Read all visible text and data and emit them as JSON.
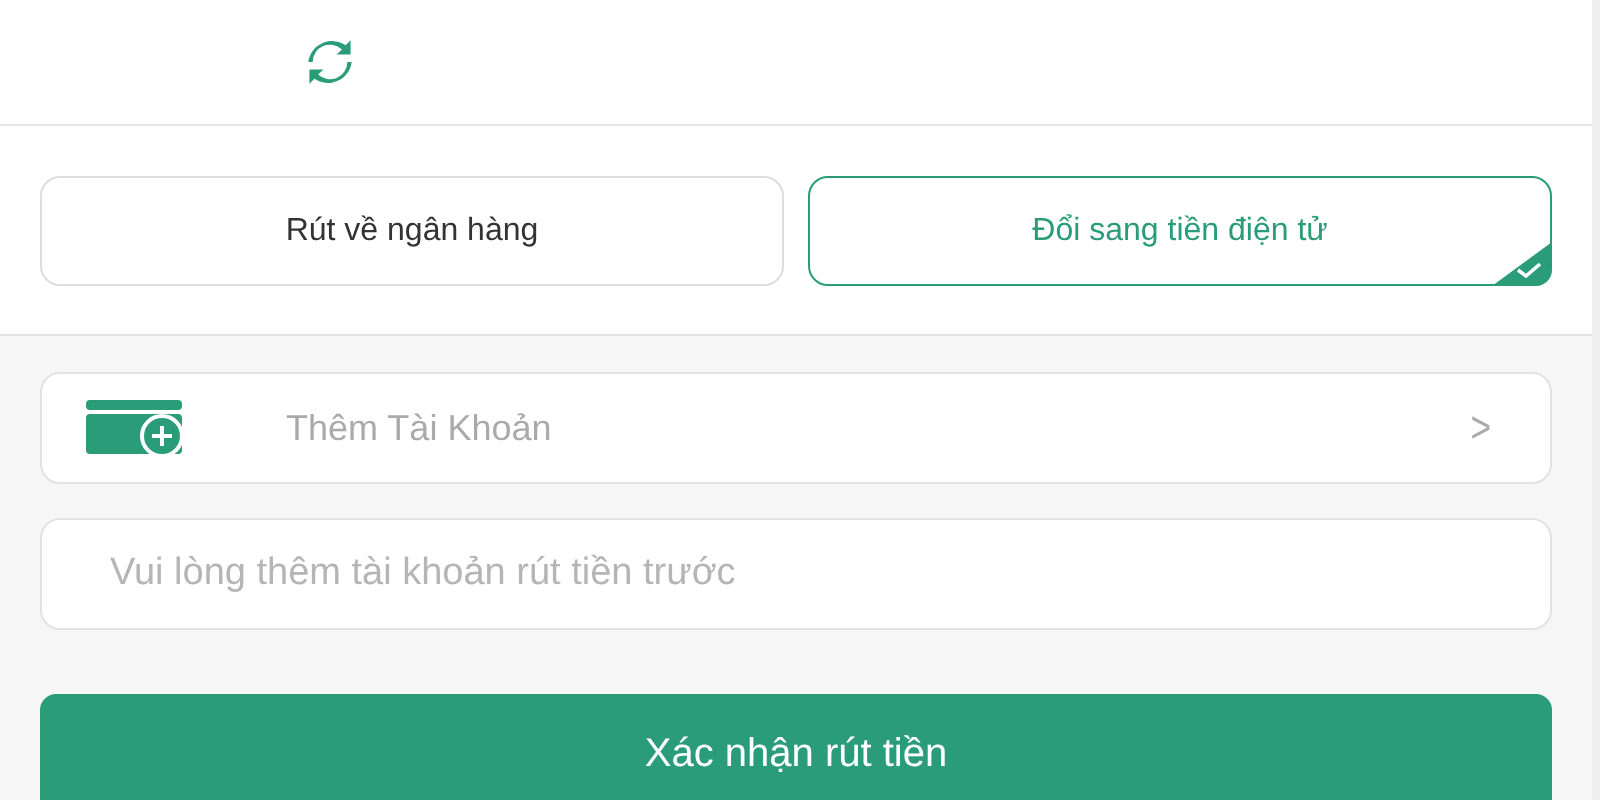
{
  "tabs": [
    {
      "label": "Rút về ngân hàng",
      "selected": false
    },
    {
      "label": "Đổi sang tiền điện tử",
      "selected": true
    }
  ],
  "account_picker": {
    "label": "Thêm Tài Khoản",
    "chevron": ">"
  },
  "account_field": {
    "placeholder": "Vui lòng thêm tài khoản rút tiền trước"
  },
  "submit_button": {
    "label": "Xác nhận rút tiền"
  }
}
